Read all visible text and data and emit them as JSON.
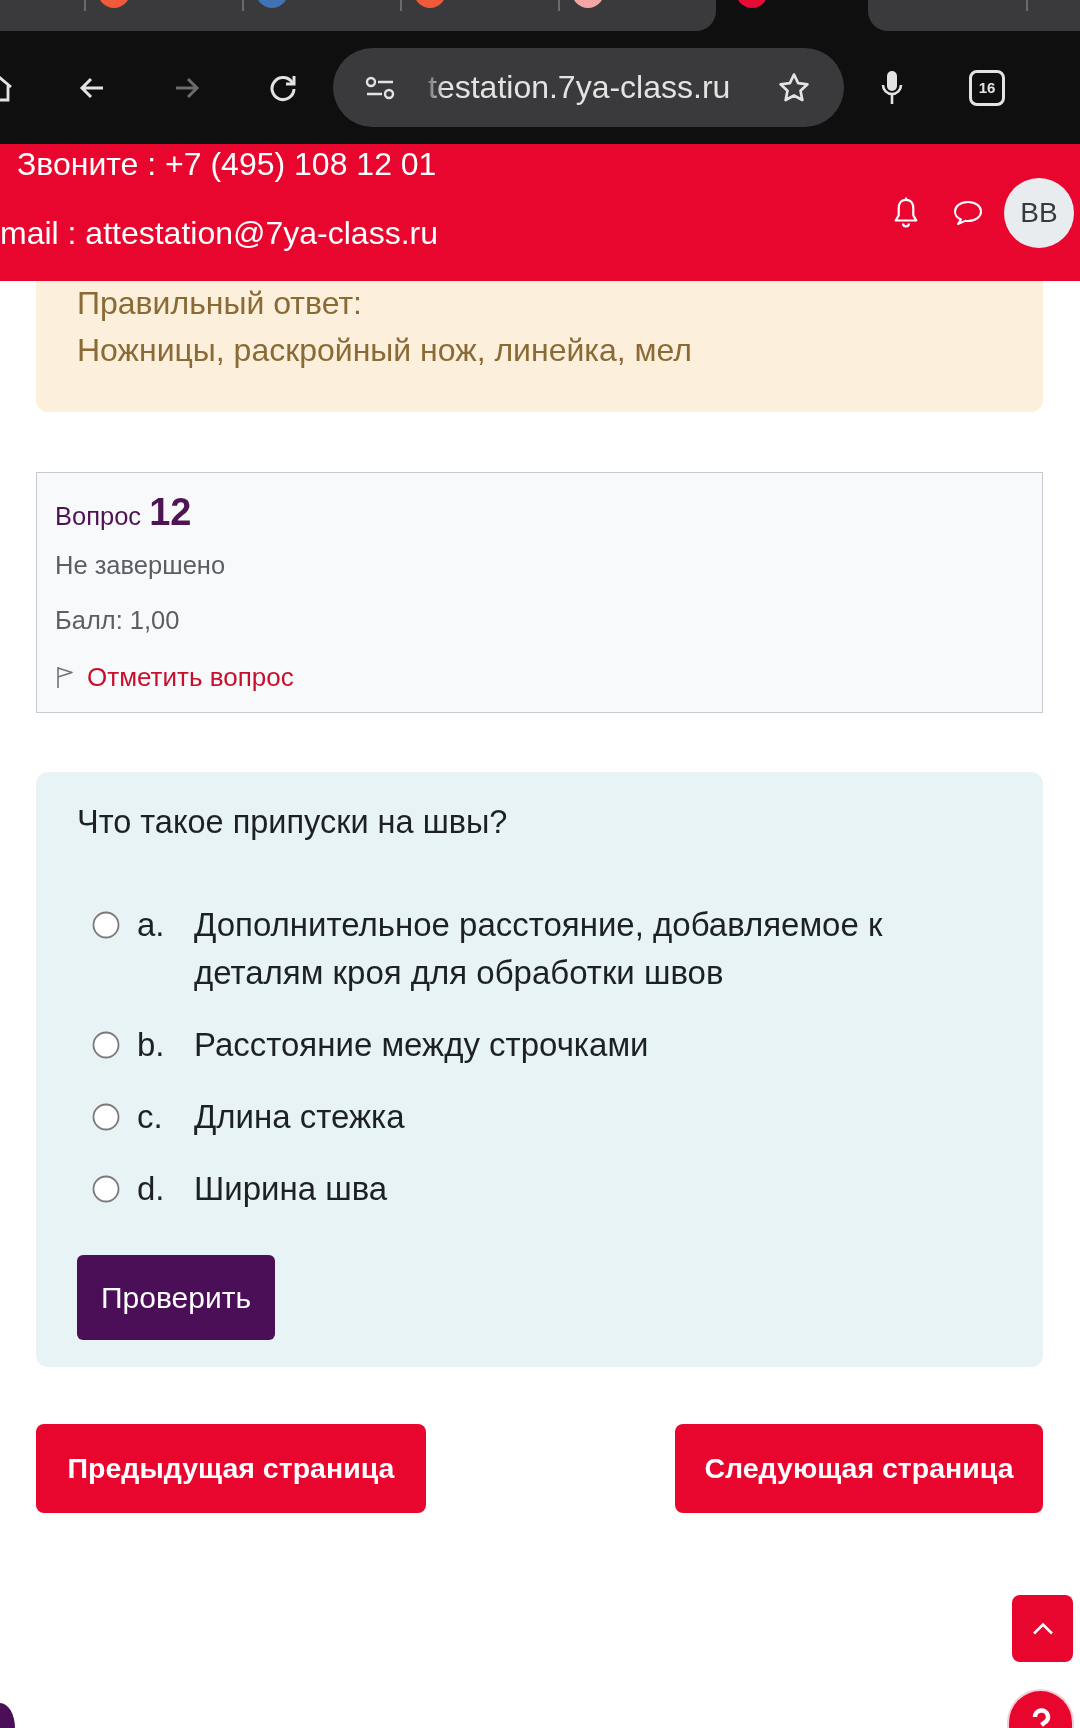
{
  "browser": {
    "tabs": [
      {
        "selected": false
      },
      {
        "selected": false,
        "color": "#ef5a3a"
      },
      {
        "selected": false,
        "color": "#3f73b5"
      },
      {
        "selected": false,
        "color": "#ef5a3a"
      },
      {
        "selected": false,
        "color": "#f4a6a6"
      },
      {
        "selected": true,
        "color": "#e60a35"
      },
      {
        "selected": false
      },
      {
        "selected": false
      }
    ],
    "forward_disabled": true,
    "url": "testation.7ya-class.ru",
    "tab_count": "16"
  },
  "header": {
    "phone": "Звоните : +7 (495) 108 12 01",
    "email": "mail : attestation@7ya-class.ru",
    "avatar": "BB"
  },
  "feedback": {
    "label": "Правильный ответ:",
    "answer": "Ножницы, раскройный нож, линейка, мел"
  },
  "question_info": {
    "label": "Вопрос",
    "number": "12",
    "status": "Не завершено",
    "grade": "Балл: 1,00",
    "flag_link": "Отметить вопрос"
  },
  "question": {
    "text": "Что такое припуски на швы?",
    "options": [
      {
        "letter": "a.",
        "text": "Дополнительное расстояние, добавляемое к деталям кроя для обработки швов",
        "selected": false
      },
      {
        "letter": "b.",
        "text": "Расстояние между строчками",
        "selected": false
      },
      {
        "letter": "c.",
        "text": "Длина стежка",
        "selected": false
      },
      {
        "letter": "d.",
        "text": "Ширина шва",
        "selected": false
      }
    ],
    "check_button": "Проверить"
  },
  "navigation": {
    "previous": "Предыдущая страница",
    "next": "Следующая страница"
  }
}
